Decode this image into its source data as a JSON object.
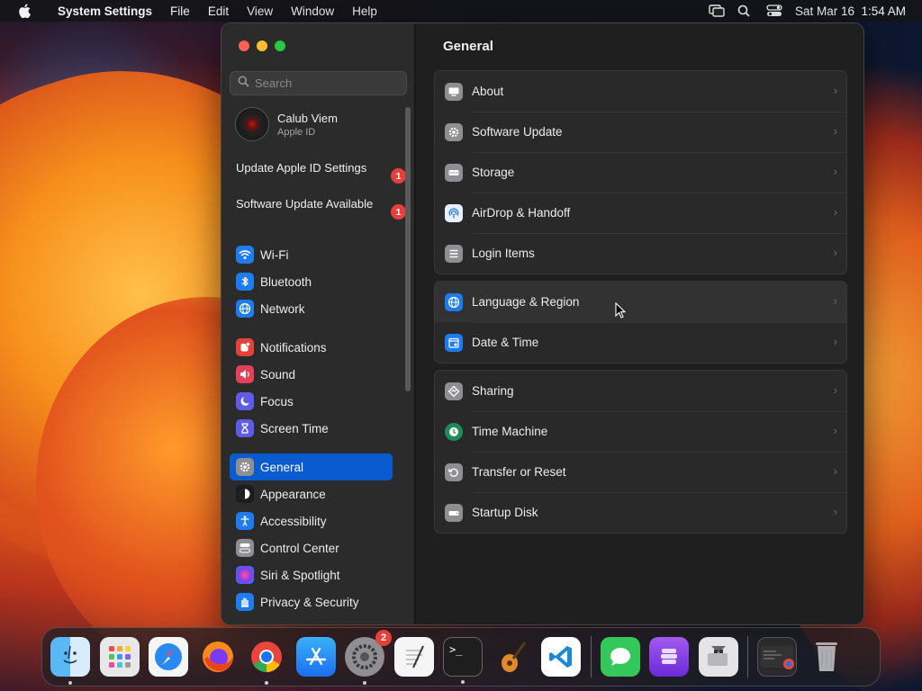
{
  "menubar": {
    "app_name": "System Settings",
    "menus": [
      "File",
      "Edit",
      "View",
      "Window",
      "Help"
    ],
    "clock": "Sat Mar 16  1:54 AM"
  },
  "window": {
    "search": {
      "placeholder": "Search",
      "value": ""
    },
    "account": {
      "name": "Calub Viem",
      "subtitle": "Apple ID"
    },
    "notices": [
      {
        "label": "Update Apple ID Settings",
        "badge": "1"
      },
      {
        "label": "Software Update Available",
        "badge": "1"
      }
    ],
    "sidebar": {
      "items": [
        {
          "label": "Wi-Fi",
          "icon": "wifi-icon",
          "color": "#1e7cf0"
        },
        {
          "label": "Bluetooth",
          "icon": "bluetooth-icon",
          "color": "#1e7cf0"
        },
        {
          "label": "Network",
          "icon": "globe-icon",
          "color": "#1e7cf0"
        },
        {
          "label": "Notifications",
          "icon": "bell-icon",
          "color": "#e5403a"
        },
        {
          "label": "Sound",
          "icon": "speaker-icon",
          "color": "#e5405a"
        },
        {
          "label": "Focus",
          "icon": "moon-icon",
          "color": "#5e5ce6"
        },
        {
          "label": "Screen Time",
          "icon": "hourglass-icon",
          "color": "#5e5ce6"
        },
        {
          "label": "General",
          "icon": "gear-icon",
          "color": "#8e8e93",
          "active": true
        },
        {
          "label": "Appearance",
          "icon": "appearance-icon",
          "color": "#1c1c1e"
        },
        {
          "label": "Accessibility",
          "icon": "accessibility-icon",
          "color": "#1e7cf0"
        },
        {
          "label": "Control Center",
          "icon": "control-center-icon",
          "color": "#8e8e93"
        },
        {
          "label": "Siri & Spotlight",
          "icon": "siri-icon",
          "color": "#b04ae0"
        },
        {
          "label": "Privacy & Security",
          "icon": "hand-icon",
          "color": "#1e7cf0"
        }
      ]
    },
    "content": {
      "title": "General",
      "groups": [
        [
          {
            "label": "About",
            "icon": "display-icon",
            "color": "#8e8e93"
          },
          {
            "label": "Software Update",
            "icon": "gear-icon",
            "color": "#8e8e93"
          },
          {
            "label": "Storage",
            "icon": "storage-icon",
            "color": "#8e8e93"
          },
          {
            "label": "AirDrop & Handoff",
            "icon": "airdrop-icon",
            "color": "#1e7cf0"
          },
          {
            "label": "Login Items",
            "icon": "list-icon",
            "color": "#8e8e93"
          }
        ],
        [
          {
            "label": "Language & Region",
            "icon": "globe-icon",
            "color": "#1e7cf0"
          },
          {
            "label": "Date & Time",
            "icon": "calendar-icon",
            "color": "#1e7cf0"
          }
        ],
        [
          {
            "label": "Sharing",
            "icon": "sharing-icon",
            "color": "#8e8e93"
          },
          {
            "label": "Time Machine",
            "icon": "time-machine-icon",
            "color": "#1f8a5a"
          },
          {
            "label": "Transfer or Reset",
            "icon": "reset-icon",
            "color": "#8e8e93"
          },
          {
            "label": "Startup Disk",
            "icon": "disk-icon",
            "color": "#8e8e93"
          }
        ]
      ]
    }
  },
  "dock": {
    "apps": [
      {
        "name": "Finder",
        "icon": "finder-icon",
        "running": true
      },
      {
        "name": "Launchpad",
        "icon": "launchpad-icon",
        "running": false
      },
      {
        "name": "Safari",
        "icon": "safari-icon",
        "running": false
      },
      {
        "name": "Firefox",
        "icon": "firefox-icon",
        "running": false
      },
      {
        "name": "Chrome",
        "icon": "chrome-icon",
        "running": true
      },
      {
        "name": "App Store",
        "icon": "app-store-icon",
        "running": false
      },
      {
        "name": "System Settings",
        "icon": "system-settings-icon",
        "running": true,
        "badge": "2"
      },
      {
        "name": "TextEdit",
        "icon": "textedit-icon",
        "running": false
      },
      {
        "name": "Terminal",
        "icon": "terminal-icon",
        "running": true
      },
      {
        "name": "GarageBand",
        "icon": "garageband-icon",
        "running": false
      },
      {
        "name": "VS Code",
        "icon": "vscode-icon",
        "running": false
      },
      {
        "name": "Messages",
        "icon": "messages-icon",
        "running": false
      },
      {
        "name": "Podcasts",
        "icon": "podcasts-icon",
        "running": false
      },
      {
        "name": "Boot Camp",
        "icon": "bootcamp-icon",
        "running": false
      },
      {
        "name": "Chrome Window",
        "icon": "chrome-window-icon",
        "running": false
      },
      {
        "name": "Trash",
        "icon": "trash-icon",
        "running": false
      }
    ]
  }
}
